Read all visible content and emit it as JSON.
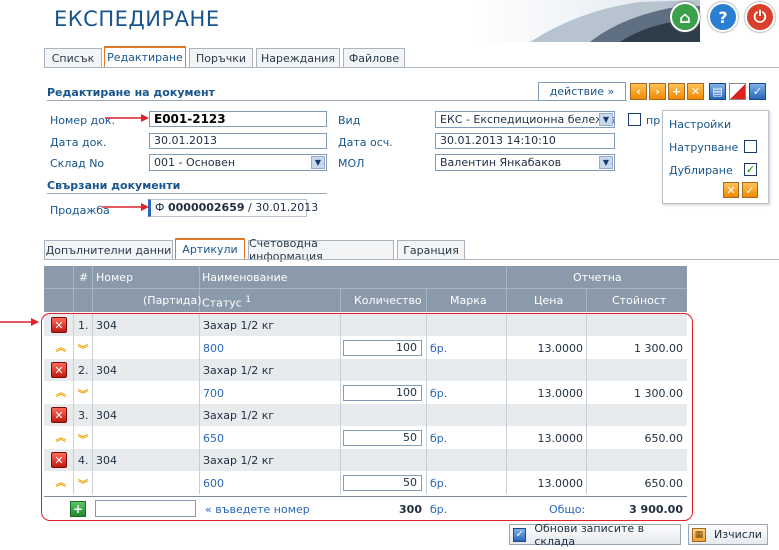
{
  "header": {
    "title": "ЕКСПЕДИРАНЕ"
  },
  "tabs": [
    {
      "label": "Списък"
    },
    {
      "label": "Редактиране"
    },
    {
      "label": "Поръчки"
    },
    {
      "label": "Нареждания"
    },
    {
      "label": "Файлове"
    }
  ],
  "form": {
    "section_title": "Редактиране на документ",
    "action_label": "действие »",
    "doc_no_label": "Номер док.",
    "doc_no_value": "Е001-2123",
    "doc_date_label": "Дата док.",
    "doc_date_value": "30.01.2013",
    "warehouse_label": "Склад No",
    "warehouse_value": "001 - Основен",
    "type_label": "Вид",
    "type_value": "ЕКС - Експедиционна бележка",
    "post_date_label": "Дата осч.",
    "post_date_value": "30.01.2013 14:10:10",
    "mol_label": "МОЛ",
    "mol_value": "Валентин Янкабаков",
    "extra_checkbox_label": "пр"
  },
  "settings": {
    "title": "Настройки",
    "accumulate_label": "Натрупване",
    "duplicate_label": "Дублиране"
  },
  "related": {
    "title": "Свързани документи",
    "sale_label": "Продажба",
    "sale_prefix": "Ф",
    "sale_number": "0000002659",
    "sale_date": "/ 30.01.2013"
  },
  "subtabs": [
    {
      "label": "Допълнителни данни"
    },
    {
      "label": "Артикули"
    },
    {
      "label": "Счетоводна информация"
    },
    {
      "label": "Гаранция"
    }
  ],
  "grid": {
    "h_hash": "#",
    "h_number": "Номер",
    "h_batch": "(Партида)",
    "h_name": "Наименование",
    "h_status": "Статус",
    "h_status_sup": "1",
    "h_qty": "Количество",
    "h_unit": "Марка",
    "h_reporting": "Отчетна",
    "h_price": "Цена",
    "h_value": "Стойност",
    "rows": [
      {
        "idx": "1.",
        "code": "304",
        "name": "Захар 1/2 кг",
        "status": "800",
        "qty": "100",
        "unit": "бр.",
        "price": "13.0000",
        "value": "1 300.00"
      },
      {
        "idx": "2.",
        "code": "304",
        "name": "Захар 1/2 кг",
        "status": "700",
        "qty": "100",
        "unit": "бр.",
        "price": "13.0000",
        "value": "1 300.00"
      },
      {
        "idx": "3.",
        "code": "304",
        "name": "Захар 1/2 кг",
        "status": "650",
        "qty": "50",
        "unit": "бр.",
        "price": "13.0000",
        "value": "650.00"
      },
      {
        "idx": "4.",
        "code": "304",
        "name": "Захар 1/2 кг",
        "status": "600",
        "qty": "50",
        "unit": "бр.",
        "price": "13.0000",
        "value": "650.00"
      }
    ],
    "footer": {
      "enter_number": "« въведете номер",
      "total_qty": "300",
      "unit": "бр.",
      "total_label": "Общо:",
      "total_value": "3 900.00"
    }
  },
  "bottom": {
    "update_label": "Обнови записите в склада",
    "calc_label": "Изчисли"
  },
  "colors": {
    "brand": "#17558c",
    "accent": "#e0782a",
    "highlight": "#e0202a"
  }
}
